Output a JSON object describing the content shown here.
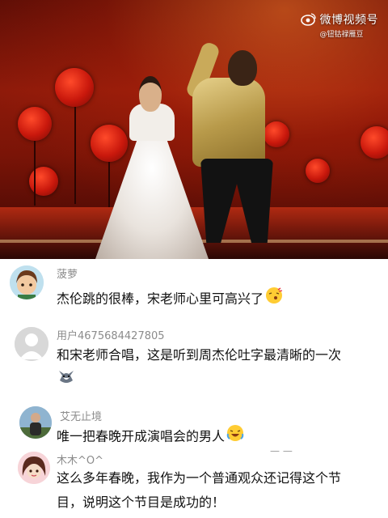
{
  "watermark": {
    "title": "微博视频号",
    "handle": "@钮钴禄雁豆",
    "icon": "weibo-eye-icon"
  },
  "comments": [
    {
      "username": "菠萝",
      "text": "杰伦跳的很棒，宋老师心里可高兴了",
      "emoji": "kissing-face-emoji",
      "avatar": "cartoon-boy-avatar"
    },
    {
      "username": "用户4675684427805",
      "text_line1": "和宋老师合唱，这是听到周杰伦吐字最清晰的一次",
      "emoji": "husky-dog-emoji",
      "avatar": "default-gray-avatar"
    },
    {
      "username": "艾无止境",
      "text": "唯一把春晚开成演唱会的男人",
      "emoji": "laughing-tears-emoji",
      "avatar": "photo-person-avatar"
    },
    {
      "username": "木木^O^",
      "text_line1": "这么多年春晚，我作为一个普通观众还记得这个节",
      "text_line2": "目，说明这个节目是成功的！",
      "avatar": "anime-girl-avatar",
      "side_marks": "—  —"
    }
  ],
  "colors": {
    "username": "#8b8b8b",
    "text": "#111111",
    "stage_red": "#c9180c"
  }
}
